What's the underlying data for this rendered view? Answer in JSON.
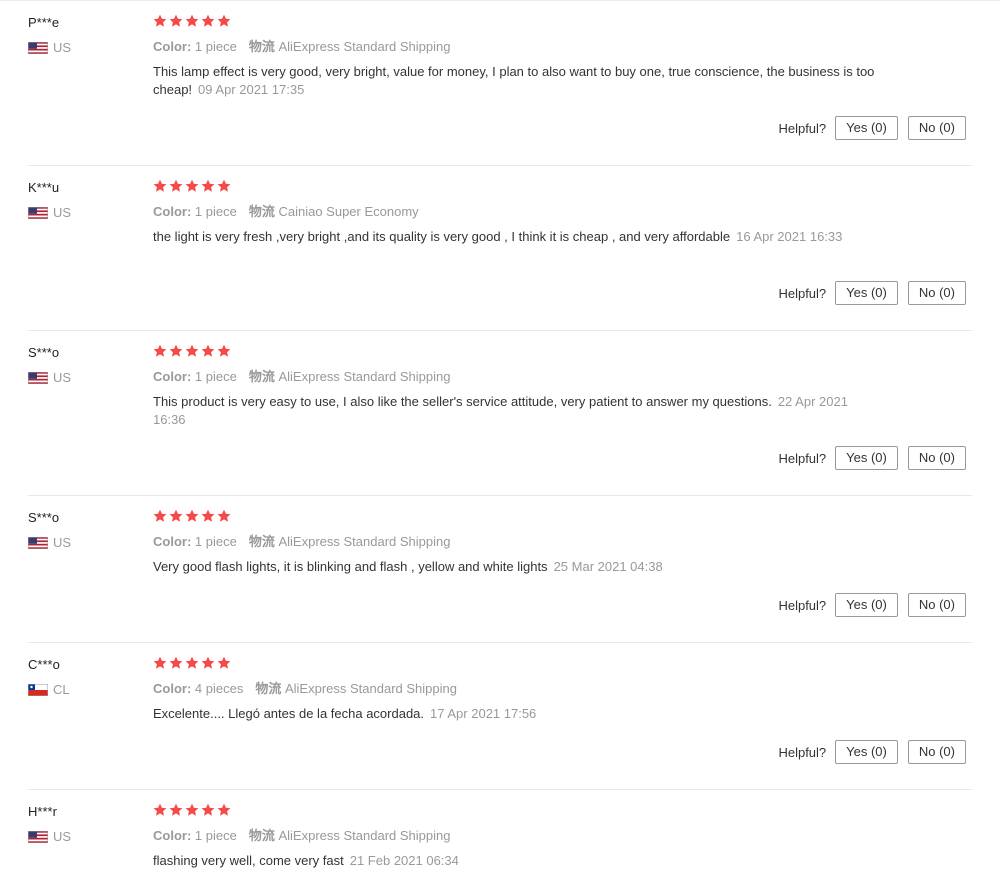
{
  "helpful_label": "Helpful?",
  "colors": {
    "star": "#f44a4a",
    "muted": "#999999",
    "text": "#333333"
  },
  "reviews": [
    {
      "user": "P***e",
      "country": "US",
      "flag": "us-flag-icon",
      "rating": 5,
      "color_key": "Color:",
      "color_value": "1 piece",
      "shipping_key": "物流",
      "shipping_value": "AliExpress Standard Shipping",
      "text": "This lamp effect is very good, very bright, value for money, I plan to also want to buy one, true conscience, the business is too cheap!",
      "date": "09 Apr 2021 17:35",
      "yes": "Yes (0)",
      "no": "No (0)"
    },
    {
      "user": "K***u",
      "country": "US",
      "flag": "us-flag-icon",
      "rating": 5,
      "color_key": "Color:",
      "color_value": "1 piece",
      "shipping_key": "物流",
      "shipping_value": "Cainiao Super Economy",
      "text": "the light is very fresh ,very bright ,and its quality is very good , I think it is cheap , and very affordable",
      "date": "16 Apr 2021 16:33",
      "yes": "Yes (0)",
      "no": "No (0)"
    },
    {
      "user": "S***o",
      "country": "US",
      "flag": "us-flag-icon",
      "rating": 5,
      "color_key": "Color:",
      "color_value": "1 piece",
      "shipping_key": "物流",
      "shipping_value": "AliExpress Standard Shipping",
      "text": "This product is very easy to use, I also like the seller's service attitude, very patient to answer my questions.",
      "date": "22 Apr 2021 16:36",
      "yes": "Yes (0)",
      "no": "No (0)"
    },
    {
      "user": "S***o",
      "country": "US",
      "flag": "us-flag-icon",
      "rating": 5,
      "color_key": "Color:",
      "color_value": "1 piece",
      "shipping_key": "物流",
      "shipping_value": "AliExpress Standard Shipping",
      "text": "Very good flash lights, it is blinking and flash , yellow and white lights",
      "date": "25 Mar 2021 04:38",
      "yes": "Yes (0)",
      "no": "No (0)"
    },
    {
      "user": "C***o",
      "country": "CL",
      "flag": "cl-flag-icon",
      "rating": 5,
      "color_key": "Color:",
      "color_value": "4 pieces",
      "shipping_key": "物流",
      "shipping_value": "AliExpress Standard Shipping",
      "text": "Excelente.... Llegó antes de la fecha acordada.",
      "date": "17 Apr 2021 17:56",
      "yes": "Yes (0)",
      "no": "No (0)"
    },
    {
      "user": "H***r",
      "country": "US",
      "flag": "us-flag-icon",
      "rating": 5,
      "color_key": "Color:",
      "color_value": "1 piece",
      "shipping_key": "物流",
      "shipping_value": "AliExpress Standard Shipping",
      "text": "flashing very well, come very fast",
      "date": "21 Feb 2021 06:34",
      "yes": "Yes (0)",
      "no": "No (0)"
    }
  ]
}
